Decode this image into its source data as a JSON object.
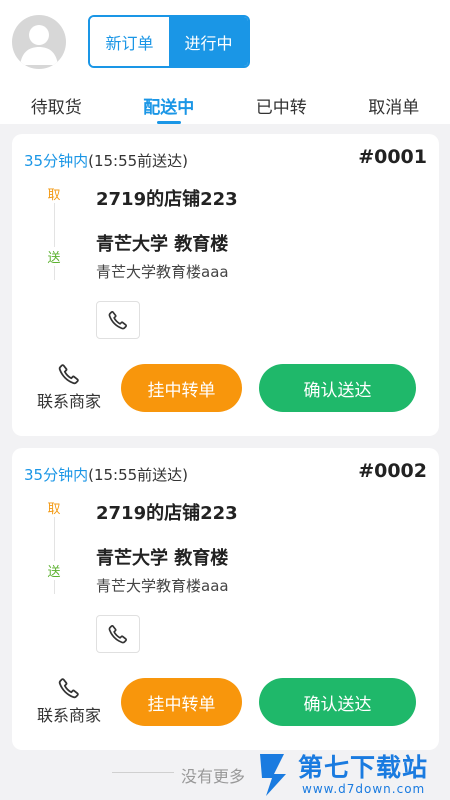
{
  "header": {
    "segments": [
      {
        "label": "新订单",
        "active": false
      },
      {
        "label": "进行中",
        "active": true
      }
    ]
  },
  "tabs": [
    {
      "label": "待取货",
      "active": false
    },
    {
      "label": "配送中",
      "active": true
    },
    {
      "label": "已中转",
      "active": false
    },
    {
      "label": "取消单",
      "active": false
    }
  ],
  "orders": [
    {
      "time_main": "35分钟内",
      "time_sub": "(15:55前送达)",
      "order_no": "#0001",
      "pickup_tag": "取",
      "delivery_tag": "送",
      "shop_name": "2719的店铺223",
      "address_name": "青芒大学 教育楼",
      "address_detail": "青芒大学教育楼aaa",
      "contact_label": "联系商家",
      "transfer_label": "挂中转单",
      "confirm_label": "确认送达"
    },
    {
      "time_main": "35分钟内",
      "time_sub": "(15:55前送达)",
      "order_no": "#0002",
      "pickup_tag": "取",
      "delivery_tag": "送",
      "shop_name": "2719的店铺223",
      "address_name": "青芒大学 教育楼",
      "address_detail": "青芒大学教育楼aaa",
      "contact_label": "联系商家",
      "transfer_label": "挂中转单",
      "confirm_label": "确认送达"
    }
  ],
  "footer": {
    "text": "没有更多"
  },
  "watermark": {
    "title": "第七下载站",
    "url": "www.d7down.com"
  },
  "colors": {
    "accent": "#1a96e6",
    "transfer": "#f8960c",
    "confirm": "#1fb86a",
    "pickup": "#f39b17",
    "delivery": "#5cb12f"
  },
  "icons": {
    "avatar": "user-avatar-icon",
    "phone": "phone-icon"
  }
}
